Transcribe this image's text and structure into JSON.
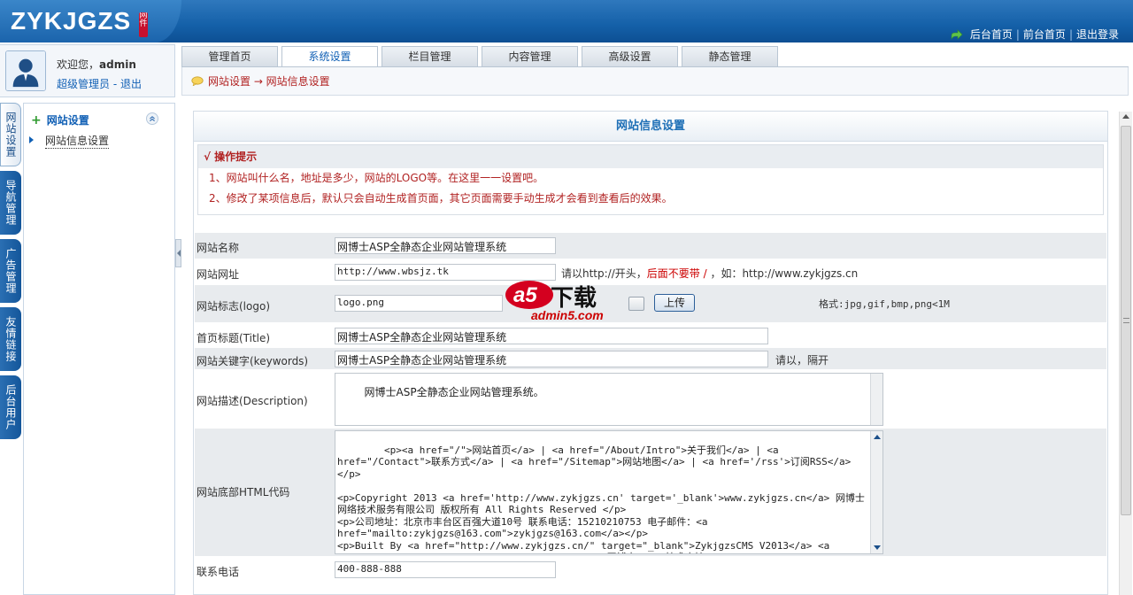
{
  "header": {
    "logo": "ZYKJGZS",
    "seal": "网件",
    "links": [
      "后台首页",
      "前台首页",
      "退出登录"
    ],
    "separator": "|"
  },
  "user": {
    "welcome": "欢迎您，",
    "name": "admin",
    "role": "超级管理员",
    "dash": " - ",
    "logout": "退出"
  },
  "tabs": [
    {
      "label": "管理首页"
    },
    {
      "label": "系统设置"
    },
    {
      "label": "栏目管理"
    },
    {
      "label": "内容管理"
    },
    {
      "label": "高级设置"
    },
    {
      "label": "静态管理"
    }
  ],
  "breadcrumb": "网站设置 → 网站信息设置",
  "vtabs": [
    {
      "label": "网站设置"
    },
    {
      "label": "导航管理"
    },
    {
      "label": "广告管理"
    },
    {
      "label": "友情链接"
    },
    {
      "label": "后台用户"
    }
  ],
  "nav": {
    "heading": "网站设置",
    "item": "网站信息设置"
  },
  "content": {
    "title": "网站信息设置",
    "tip_head": "√ 操作提示",
    "tips": [
      "1、网站叫什么名，地址是多少，网站的LOGO等。在这里一一设置吧。",
      "2、修改了某项信息后，默认只会自动生成首页面，其它页面需要手动生成才会看到查看后的效果。"
    ]
  },
  "form": {
    "site_name": {
      "label": "网站名称",
      "value": "网博士ASP全静态企业网站管理系统"
    },
    "site_url": {
      "label": "网站网址",
      "value": "http://www.wbsjz.tk",
      "note_a": "请以http://开头，",
      "note_red": "后面不要带 / ",
      "note_b": "，如：http://www.zykjgzs.cn"
    },
    "logo": {
      "label": "网站标志(logo)",
      "value": "logo.png",
      "upload": "上传",
      "format": "格式:jpg,gif,bmp,png<1M"
    },
    "title": {
      "label": "首页标题(Title)",
      "value": "网博士ASP全静态企业网站管理系统"
    },
    "keywords": {
      "label": "网站关键字(keywords)",
      "value": "网博士ASP全静态企业网站管理系统",
      "note": "请以，隔开"
    },
    "description": {
      "label": "网站描述(Description)",
      "value": "网博士ASP全静态企业网站管理系统。"
    },
    "footer": {
      "label": "网站底部HTML代码",
      "value": "<p><a href=\"/\">网站首页</a> | <a href=\"/About/Intro\">关于我们</a> | <a href=\"/Contact\">联系方式</a> | <a href=\"/Sitemap\">网站地图</a> | <a href='/rss'>订阅RSS</a></p>\n\n<p>Copyright 2013 <a href='http://www.zykjgzs.cn' target='_blank'>www.zykjgzs.cn</a> 网博士网络技术服务有限公司 版权所有 All Rights Reserved </p>\n<p>公司地址：北京市丰台区百强大道10号 联系电话：15210210753 电子邮件：<a href=\"mailto:zykjgzs@163.com\">zykjgzs@163.com</a></p>\n<p>Built By <a href=\"http://www.zykjgzs.cn/\" target=\"_blank\">ZykjgzsCMS V2013</a> <a href=\"http://www.zykjgzs.cn/\" target=\"_blank\">网博士</a> 技术支持 <a href=\"/rss\" target=\"_blank\"><img src=\"/images/rss_icon.gif\"></a> <a href=\"/rss/feed.xml\" target=\"_blank\"><img"
    },
    "phone": {
      "label": "联系电话",
      "value": "400-888-888"
    }
  },
  "watermark": {
    "a5": "a5",
    "xiazai": "下载",
    "url": "admin5.com"
  },
  "colors": {
    "header_blue": "#1460a8",
    "accent_red": "#b12222",
    "link_blue": "#1160b5"
  }
}
